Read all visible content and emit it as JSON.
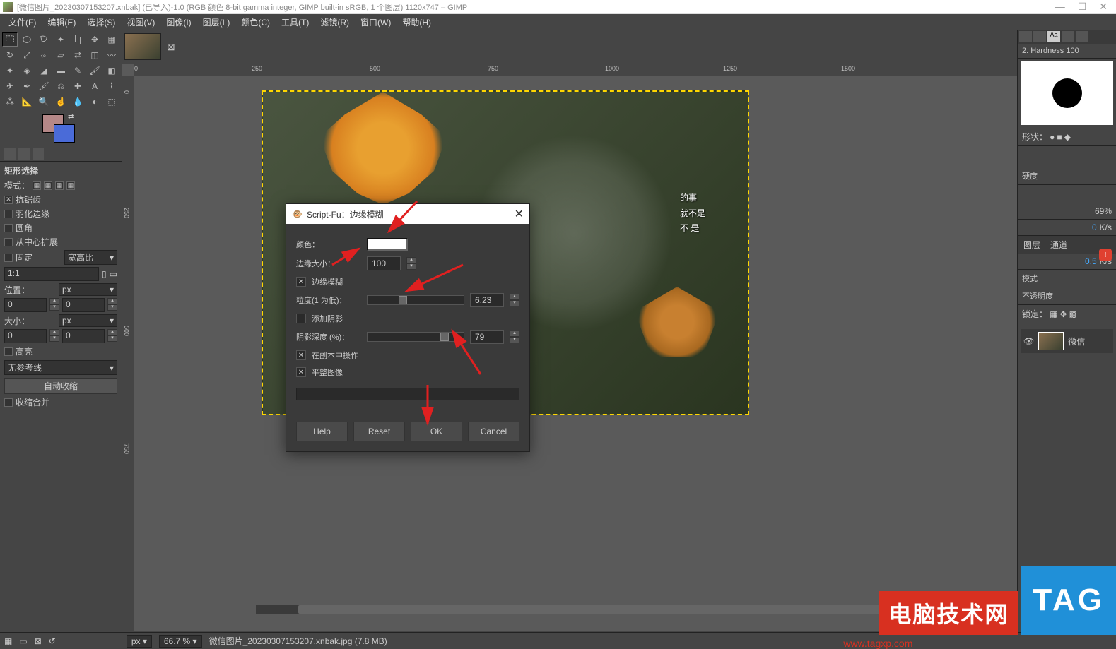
{
  "titlebar": {
    "text": "[微信图片_20230307153207.xnbak] (已导入)-1.0 (RGB 颜色 8-bit gamma integer, GIMP built-in sRGB, 1 个图层) 1120x747 – GIMP"
  },
  "menu": {
    "file": "文件(F)",
    "edit": "编辑(E)",
    "select": "选择(S)",
    "view": "视图(V)",
    "image": "图像(I)",
    "layer": "图层(L)",
    "color": "颜色(C)",
    "tools": "工具(T)",
    "filters": "滤镜(R)",
    "windows": "窗口(W)",
    "help": "帮助(H)"
  },
  "ruler_h": [
    "0",
    "250",
    "500",
    "750",
    "1000",
    "1250",
    "1500"
  ],
  "ruler_v": [
    "0",
    "250",
    "500",
    "750"
  ],
  "tool_options": {
    "title": "矩形选择",
    "mode_label": "模式：",
    "antialias": "抗锯齿",
    "feather": "羽化边缘",
    "rounded": "圆角",
    "expand_center": "从中心扩展",
    "fixed": "固定",
    "aspect_label": "宽高比",
    "ratio": "1:1",
    "position": "位置：",
    "size": "大小：",
    "px": "px",
    "val_zero": "0",
    "highlight": "高亮",
    "guides": "无参考线",
    "auto_shrink": "自动收缩",
    "shrink_merged": "收缩合并"
  },
  "dialog": {
    "title": "Script-Fu：边缘模糊",
    "color": "颜色：",
    "edge_size": "边缘大小：",
    "edge_size_val": "100",
    "edge_blur": "边缘模糊",
    "granularity": "粒度(1 为低)：",
    "granularity_val": "6.23",
    "add_shadow": "添加阴影",
    "shadow_depth": "阴影深度 (%)：",
    "shadow_depth_val": "79",
    "work_on_copy": "在副本中操作",
    "flatten": "平整图像",
    "help": "Help",
    "reset": "Reset",
    "ok": "OK",
    "cancel": "Cancel"
  },
  "right": {
    "brush_label": "2. Hardness 100",
    "shape_label": "形状：",
    "hardness_label": "硬度",
    "layers_tab": "图层",
    "channels_tab": "通道",
    "blend_mode": "模式",
    "opacity": "不透明度",
    "lock": "锁定：",
    "layer_name": "微信",
    "pct69": "69%",
    "ks": "K/s",
    "val0": "0",
    "val05": "0.5"
  },
  "image_text": {
    "l1": "的事",
    "l2": "就不是",
    "l3": "不 是"
  },
  "footer": {
    "px": "px",
    "zoom": "66.7 %",
    "status": "微信图片_20230307153207.xnbak.jpg (7.8 MB)"
  },
  "watermark": {
    "text": "电脑技术网",
    "url": "www.tagxp.com",
    "tag": "TAG"
  }
}
